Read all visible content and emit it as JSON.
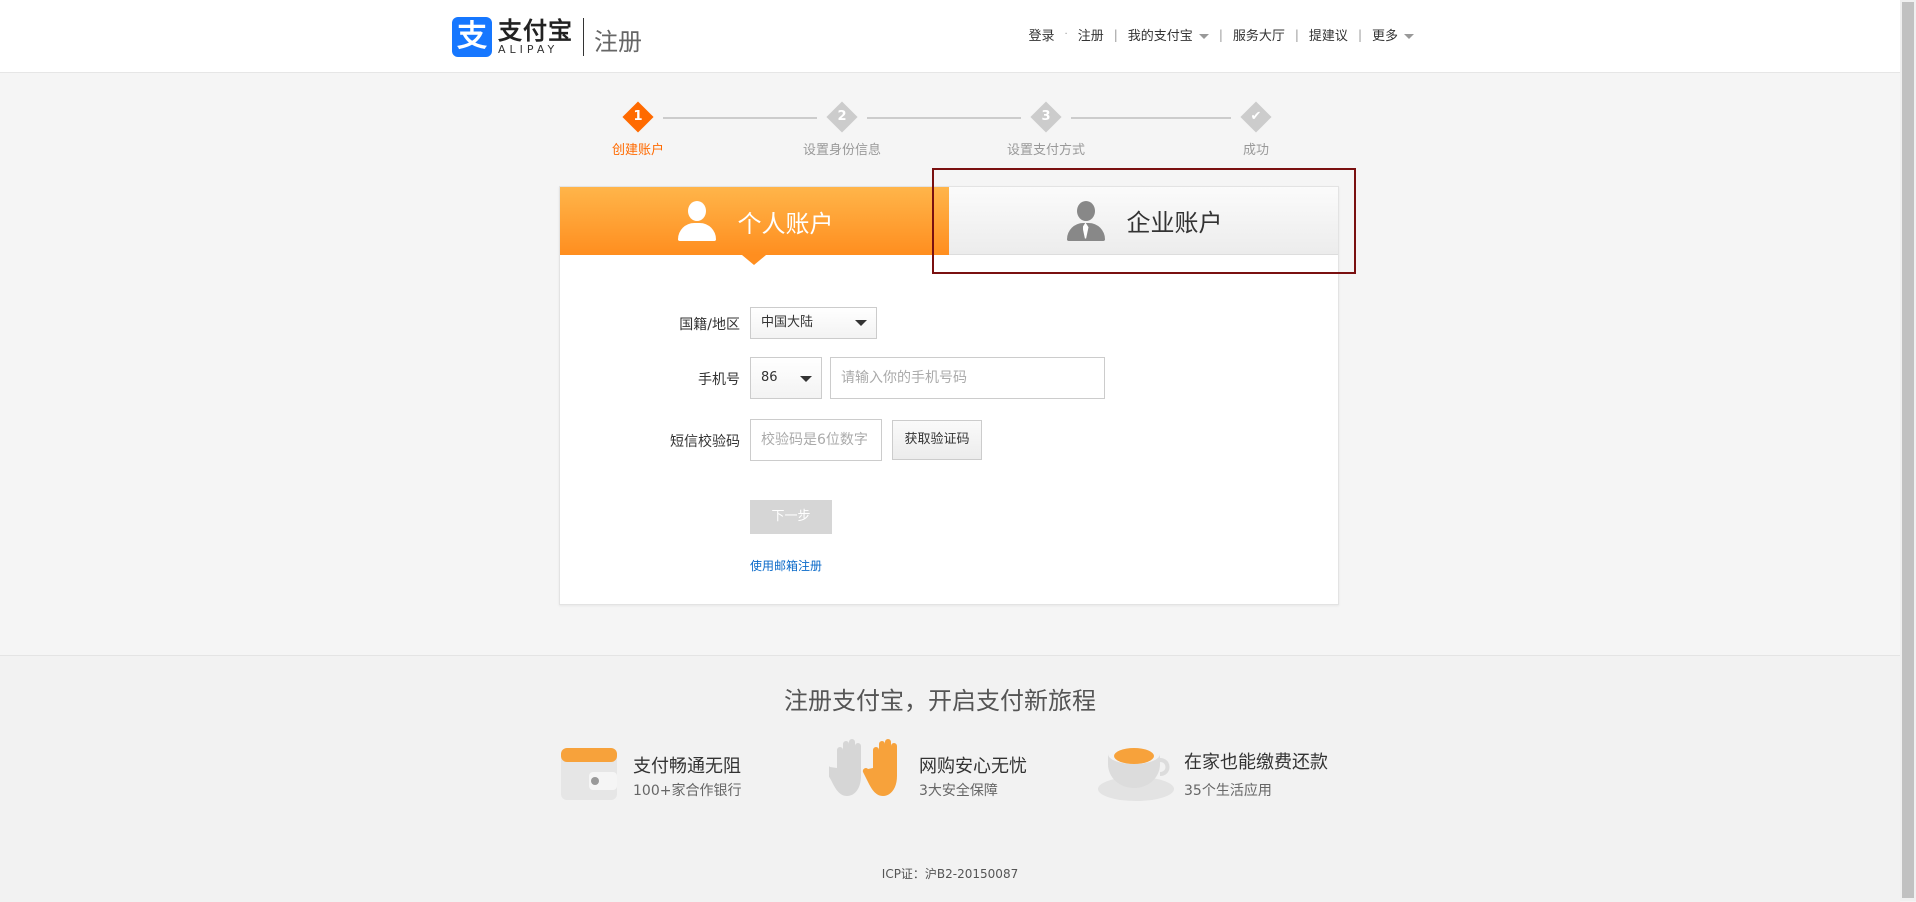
{
  "header": {
    "logo_mark": "支",
    "logo_cn": "支付宝",
    "logo_en": "ALIPAY",
    "page_title": "注册",
    "nav": {
      "login": "登录",
      "register": "注册",
      "my_alipay": "我的支付宝",
      "service_hall": "服务大厅",
      "suggestion": "提建议",
      "more": "更多"
    }
  },
  "steps": [
    {
      "number": "1",
      "label": "创建账户",
      "state": "active"
    },
    {
      "number": "2",
      "label": "设置身份信息",
      "state": "pending"
    },
    {
      "number": "3",
      "label": "设置支付方式",
      "state": "pending"
    },
    {
      "number": "✔",
      "label": "成功",
      "state": "pending"
    }
  ],
  "tabs": {
    "personal": "个人账户",
    "enterprise": "企业账户"
  },
  "form": {
    "region_label": "国籍/地区",
    "region_value": "中国大陆",
    "phone_label": "手机号",
    "country_code": "86",
    "phone_placeholder": "请输入你的手机号码",
    "sms_label": "短信校验码",
    "sms_placeholder": "校验码是6位数字",
    "get_code_button": "获取验证码",
    "next_button": "下一步",
    "email_link": "使用邮箱注册"
  },
  "footer": {
    "title": "注册支付宝，开启支付新旅程",
    "features": [
      {
        "title": "支付畅通无阻",
        "sub": "100+家合作银行",
        "icon": "wallet-icon"
      },
      {
        "title": "网购安心无忧",
        "sub": "3大安全保障",
        "icon": "hands-icon"
      },
      {
        "title": "在家也能缴费还款",
        "sub": "35个生活应用",
        "icon": "teacup-icon"
      }
    ],
    "icp": "ICP证：沪B2-20150087"
  },
  "colors": {
    "brand_blue": "#1677ff",
    "accent_orange": "#ff6a00",
    "link_blue": "#0a6ac9",
    "highlight_border": "#7a1010"
  }
}
